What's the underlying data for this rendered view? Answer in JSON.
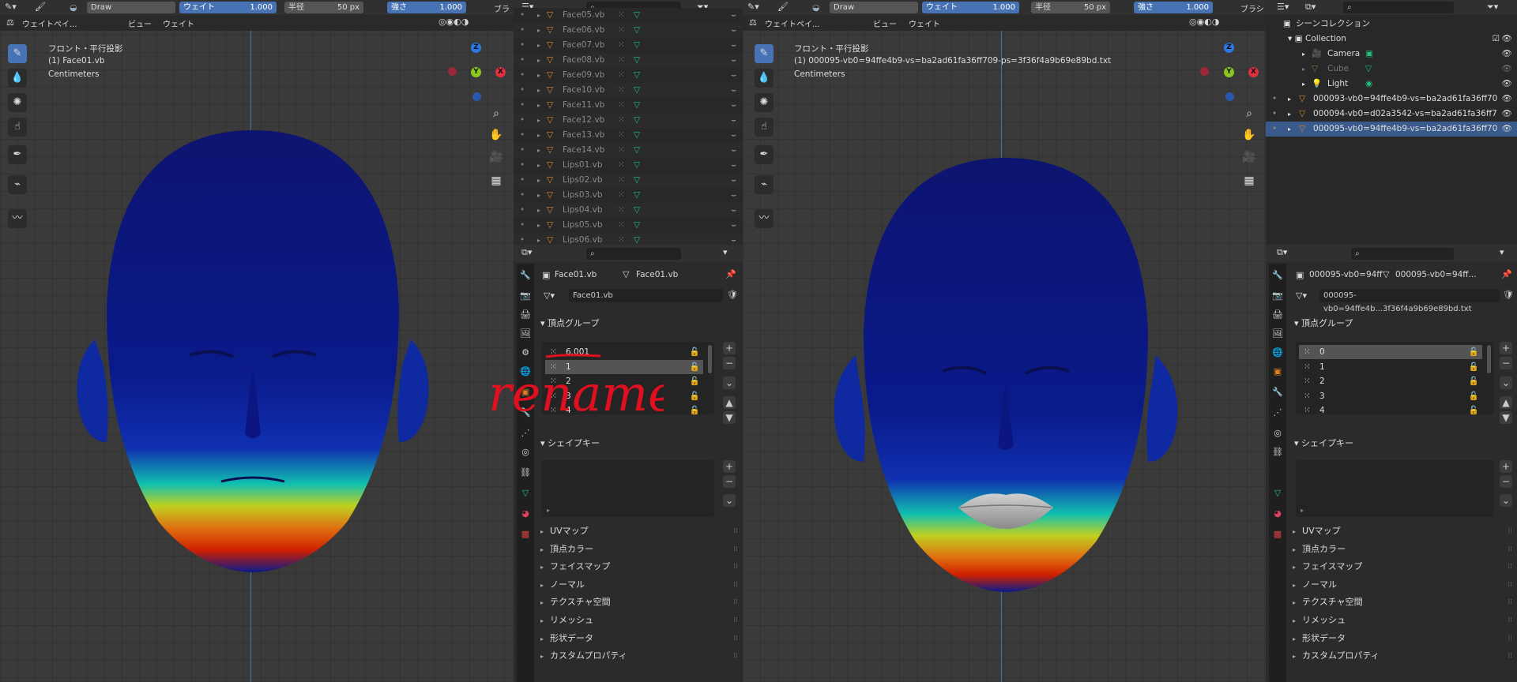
{
  "left": {
    "brush_label": "Draw",
    "weight_label": "ウェイト",
    "weight_value": "1.000",
    "radius_label": "半径",
    "radius_value": "50 px",
    "strength_label": "強さ",
    "strength_value": "1.000",
    "brush_menu": "ブラシ",
    "mode_label": "ウェイトペイ...",
    "menu_view": "ビュー",
    "menu_weight": "ウェイト",
    "view_title": "フロント・平行投影",
    "object_label": "(1) Face01.vb",
    "units": "Centimeters"
  },
  "outliner_top": {
    "rows": [
      "Face05.vb",
      "Face06.vb",
      "Face07.vb",
      "Face08.vb",
      "Face09.vb",
      "Face10.vb",
      "Face11.vb",
      "Face12.vb",
      "Face13.vb",
      "Face14.vb",
      "Lips01.vb",
      "Lips02.vb",
      "Lips03.vb",
      "Lips04.vb",
      "Lips05.vb",
      "Lips06.vb"
    ]
  },
  "props_mid": {
    "breadcrumb_obj": "Face01.vb",
    "breadcrumb_mesh": "Face01.vb",
    "mesh_name": "Face01.vb",
    "vg_header": "頂点グループ",
    "vg_items": [
      "6.001",
      "1",
      "2",
      "3",
      "4"
    ],
    "vg_selected": 1,
    "shape_header": "シェイプキー",
    "subpanels": [
      "UVマップ",
      "頂点カラー",
      "フェイスマップ",
      "ノーマル",
      "テクスチャ空間",
      "リメッシュ",
      "形状データ",
      "カスタムプロパティ"
    ],
    "annotation": "rename",
    "annotation_color": "#e01020"
  },
  "right": {
    "brush_label": "Draw",
    "weight_label": "ウェイト",
    "weight_value": "1.000",
    "radius_label": "半径",
    "radius_value": "50 px",
    "strength_label": "強さ",
    "strength_value": "1.000",
    "brush_menu": "ブラシ",
    "mode_label": "ウェイトペイ...",
    "menu_view": "ビュー",
    "menu_weight": "ウェイト",
    "view_title": "フロント・平行投影",
    "object_label": "(1) 000095-vb0=94ffe4b9-vs=ba2ad61fa36ff709-ps=3f36f4a9b69e89bd.txt",
    "units": "Centimeters"
  },
  "outliner_right": {
    "scene": "シーンコレクション",
    "collection": "Collection",
    "children": [
      "Camera",
      "Cube",
      "Light"
    ],
    "objects": [
      "000093-vb0=94ffe4b9-vs=ba2ad61fa36ff70",
      "000094-vb0=d02a3542-vs=ba2ad61fa36ff7",
      "000095-vb0=94ffe4b9-vs=ba2ad61fa36ff70"
    ]
  },
  "props_right": {
    "breadcrumb_obj": "000095-vb0=94ff",
    "breadcrumb_mesh": "000095-vb0=94ff...",
    "mesh_name": "000095-vb0=94ffe4b...3f36f4a9b69e89bd.txt",
    "vg_header": "頂点グループ",
    "vg_items": [
      "0",
      "1",
      "2",
      "3",
      "4"
    ],
    "vg_selected": 0,
    "shape_header": "シェイプキー",
    "subpanels": [
      "UVマップ",
      "頂点カラー",
      "フェイスマップ",
      "ノーマル",
      "テクスチャ空間",
      "リメッシュ",
      "形状データ",
      "カスタムプロパティ"
    ]
  },
  "gizmo": {
    "z": "Z",
    "y": "Y",
    "x": "X"
  },
  "colors": {
    "accent": "#4772b3",
    "weight_low": "#0a1a8a",
    "weight_high": "#d02000"
  }
}
